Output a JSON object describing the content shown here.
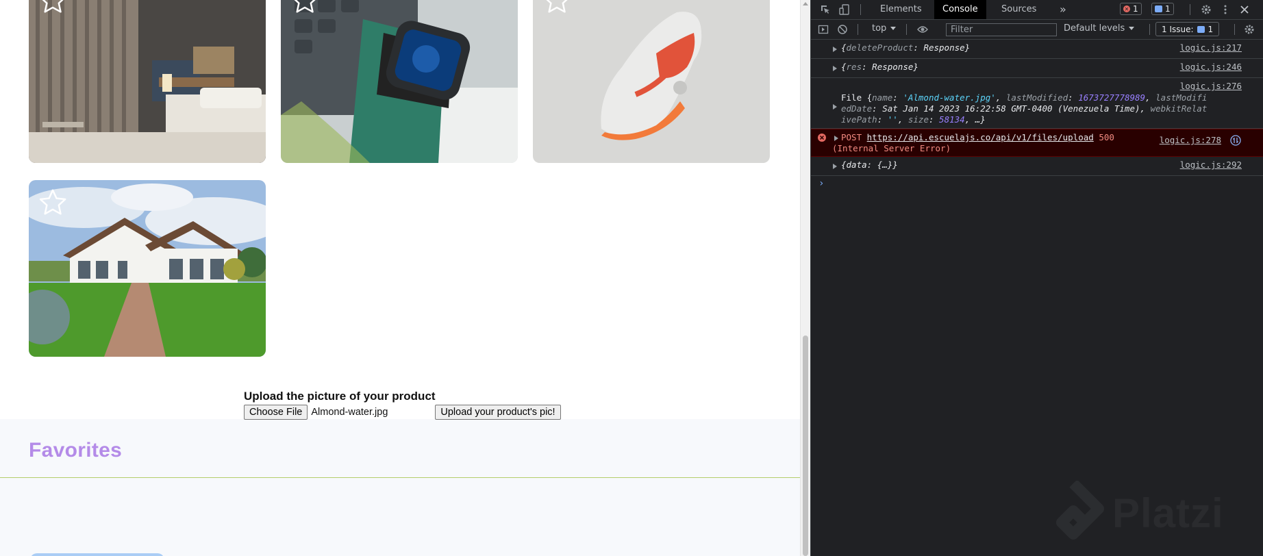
{
  "products": [
    {
      "name": "hotel-room",
      "favorite": false
    },
    {
      "name": "smartwatch",
      "favorite": false
    },
    {
      "name": "sneaker",
      "favorite": false
    },
    {
      "name": "house",
      "favorite": false
    }
  ],
  "upload": {
    "title": "Upload the picture of your product",
    "choose_label": "Choose File",
    "file_name": "Almond-water.jpg",
    "submit_label": "Upload your product's pic!"
  },
  "favorites": {
    "title": "Favorites"
  },
  "devtools": {
    "tabs": [
      "Elements",
      "Console",
      "Sources"
    ],
    "active_tab": "Console",
    "more": "»",
    "error_count": "1",
    "message_count": "1",
    "context": "top",
    "filter_placeholder": "Filter",
    "levels": "Default levels",
    "issues_label": "1 Issue:",
    "issues_count": "1",
    "logs": {
      "delete": {
        "brace_open": "{",
        "key": "deleteProduct",
        "sep": ": ",
        "value": "Response",
        "brace_close": "}",
        "source": "logic.js:217"
      },
      "res": {
        "brace_open": "{",
        "key": "res",
        "sep": ": ",
        "value": "Response",
        "brace_close": "}",
        "source": "logic.js:246"
      },
      "file": {
        "source": "logic.js:276",
        "line1_prefix": "File {",
        "k_name": "name",
        "v_name": "'Almond-water.jpg'",
        "k_modified": "lastModified",
        "v_modified": "1673727778989",
        "k_modified_date_a": "lastModifi",
        "k_modified_date_b": "edDate",
        "v_modified_date": "Sat Jan 14 2023 16:22:58 GMT-0400 (Venezuela Time)",
        "k_relpath_a": "webkitRelat",
        "k_relpath_b": "ivePath",
        "v_relpath": "''",
        "k_size": "size",
        "v_size": "58134",
        "tail": ", …}"
      },
      "error": {
        "method": "POST",
        "url": "https://api.escuelajs.co/api/v1/files/upload",
        "status": "500",
        "status_text": "(Internal Server Error)",
        "source": "logic.js:278"
      },
      "data": {
        "text": "{data: {…}}",
        "source": "logic.js:292"
      }
    },
    "prompt": "›",
    "watermark": "Platzi"
  }
}
